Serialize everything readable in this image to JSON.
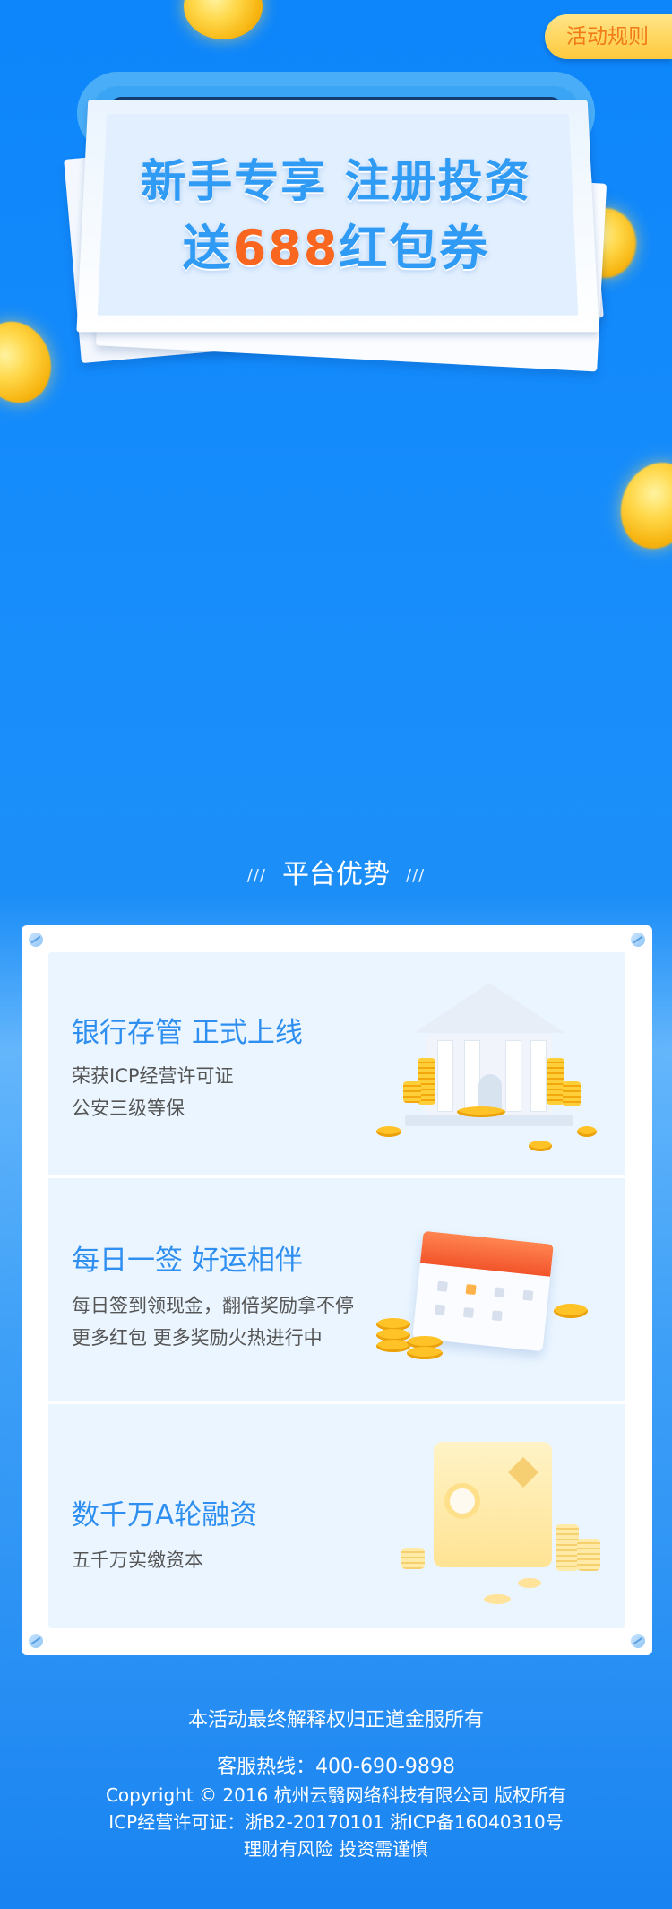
{
  "rules_button": {
    "label": "活动规则"
  },
  "hero": {
    "line1": "新手专享 注册投资",
    "line2_prefix": "送",
    "line2_amount": "688",
    "line2_suffix": "红包券"
  },
  "section": {
    "slashes_left": "///",
    "title": "平台优势",
    "slashes_right": "///"
  },
  "features": [
    {
      "title": "银行存管 正式上线",
      "lines": [
        "荣获ICP经营许可证",
        "公安三级等保"
      ],
      "icon": "bank-icon"
    },
    {
      "title": "每日一签 好运相伴",
      "lines": [
        "每日签到领现金，翻倍奖励拿不停",
        "更多红包 更多奖励火热进行中"
      ],
      "icon": "calendar-icon"
    },
    {
      "title": "数千万A轮融资",
      "lines": [
        "五千万实缴资本"
      ],
      "icon": "safe-icon"
    }
  ],
  "footer": {
    "disclaimer": "本活动最终解释权归正道金服所有",
    "hotline": "客服热线：400-690-9898",
    "copyright": "Copyright © 2016 杭州云翳网络科技有限公司 版权所有",
    "license": "ICP经营许可证：浙B2-20170101 浙ICP备16040310号",
    "risk": "理财有风险 投资需谨慎"
  },
  "colors": {
    "primary": "#0d86fb",
    "accent_orange": "#f9661f",
    "heading_blue": "#2f8ff0",
    "button_yellow": "#ffc93b"
  }
}
